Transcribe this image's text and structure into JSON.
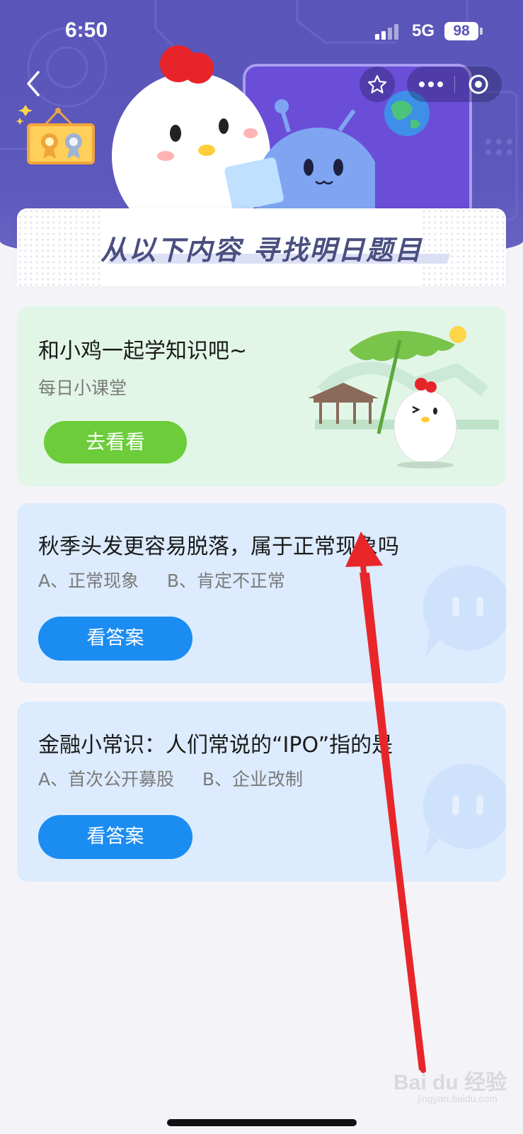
{
  "status_bar": {
    "time": "6:50",
    "network": "5G",
    "battery": "98"
  },
  "header": {
    "banner_title": "从以下内容 寻找明日题目"
  },
  "cards": [
    {
      "title": "和小鸡一起学知识吧~",
      "subtitle": "每日小课堂",
      "button_label": "去看看"
    },
    {
      "question": "秋季头发更容易脱落，属于正常现象吗",
      "options": "A、正常现象     B、肯定不正常",
      "button_label": "看答案"
    },
    {
      "question": "金融小常识：人们常说的“IPO”指的是",
      "options": "A、首次公开募股     B、企业改制",
      "button_label": "看答案"
    }
  ],
  "watermark": {
    "text": "Bai du 经验",
    "sub": "jingyan.baidu.com"
  },
  "colors": {
    "header_bg": "#5a55b8",
    "green_card": "#e2f6e7",
    "blue_card": "#dcebfd",
    "green_button": "#6ccc3a",
    "blue_button": "#1b8cf2",
    "annotation_arrow": "#e8262a"
  },
  "icons": [
    "back-chevron-icon",
    "favorite-star-icon",
    "more-dots-icon",
    "close-target-icon",
    "signal-icon",
    "battery-icon",
    "medal-icon",
    "chick-mascot-icon",
    "alien-mascot-icon",
    "chat-bubble-icon"
  ]
}
